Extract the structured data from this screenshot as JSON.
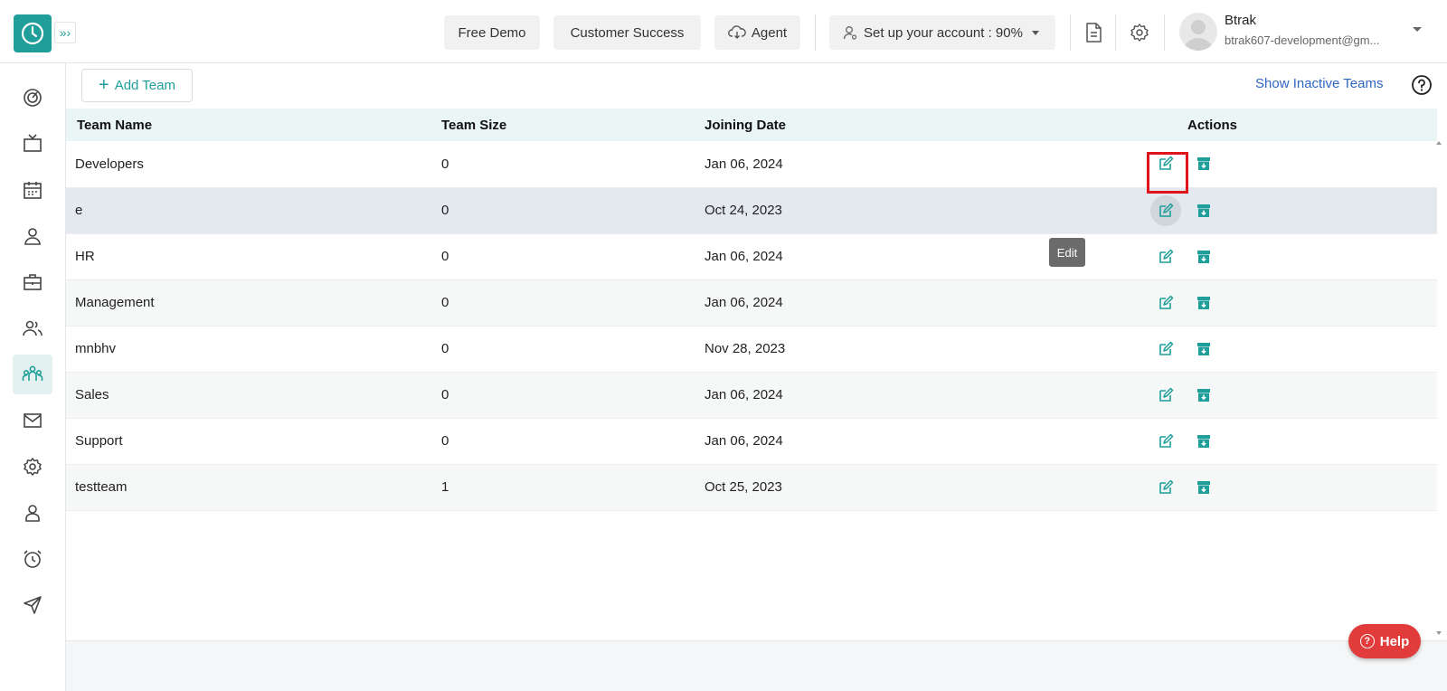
{
  "header": {
    "free_demo": "Free Demo",
    "customer_success": "Customer Success",
    "agent": "Agent",
    "setup": "Set up your account : 90%",
    "user_name": "Btrak",
    "user_email": "btrak607-development@gm..."
  },
  "toolbar": {
    "add_team": "Add Team",
    "show_inactive": "Show Inactive Teams"
  },
  "table": {
    "headers": [
      "Team Name",
      "Team Size",
      "Joining Date",
      "Actions"
    ],
    "rows": [
      {
        "name": "Developers",
        "size": "0",
        "date": "Jan 06, 2024"
      },
      {
        "name": "e",
        "size": "0",
        "date": "Oct 24, 2023"
      },
      {
        "name": "HR",
        "size": "0",
        "date": "Jan 06, 2024"
      },
      {
        "name": "Management",
        "size": "0",
        "date": "Jan 06, 2024"
      },
      {
        "name": "mnbhv",
        "size": "0",
        "date": "Nov 28, 2023"
      },
      {
        "name": "Sales",
        "size": "0",
        "date": "Jan 06, 2024"
      },
      {
        "name": "Support",
        "size": "0",
        "date": "Jan 06, 2024"
      },
      {
        "name": "testteam",
        "size": "1",
        "date": "Oct 25, 2023"
      }
    ]
  },
  "tooltip": "Edit",
  "help": "Help",
  "colors": {
    "accent": "#1f9e9a",
    "link": "#2f66c4",
    "help": "#e23b3b",
    "highlight": "#e0151c"
  },
  "sidebar_icons": [
    "dashboard-icon",
    "tv-icon",
    "calendar-icon",
    "user-icon",
    "briefcase-icon",
    "users-icon",
    "team-icon",
    "mail-icon",
    "settings-icon",
    "profile-icon",
    "alarm-icon",
    "send-icon"
  ]
}
